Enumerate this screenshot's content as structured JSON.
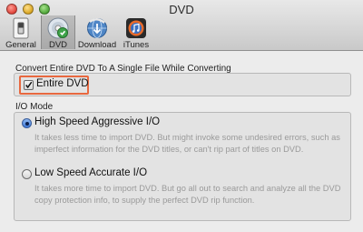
{
  "window": {
    "title": "DVD"
  },
  "toolbar": {
    "items": [
      {
        "label": "General",
        "icon": "switch-icon",
        "selected": false
      },
      {
        "label": "DVD",
        "icon": "dvd-disc-icon",
        "selected": true
      },
      {
        "label": "Download",
        "icon": "download-globe-icon",
        "selected": false
      },
      {
        "label": "iTunes",
        "icon": "itunes-icon",
        "selected": false
      }
    ]
  },
  "convert": {
    "section_label": "Convert Entire DVD To A Single File While Converting",
    "checkbox_label": "Entire DVD",
    "checked": true
  },
  "io": {
    "section_label": "I/O Mode",
    "options": [
      {
        "label": "High Speed Aggressive I/O",
        "selected": true,
        "description": "It takes less time to import DVD. But might invoke some undesired errors, such as imperfect information for the DVD titles, or can't rip part of titles on DVD."
      },
      {
        "label": "Low Speed Accurate I/O",
        "selected": false,
        "description": "It takes more time to import DVD. But go all out to search and analyze all the DVD copy protection info, to supply the perfect DVD rip function."
      }
    ]
  },
  "colors": {
    "highlight": "#e8683f",
    "radio_selected": "#3d77d6"
  }
}
